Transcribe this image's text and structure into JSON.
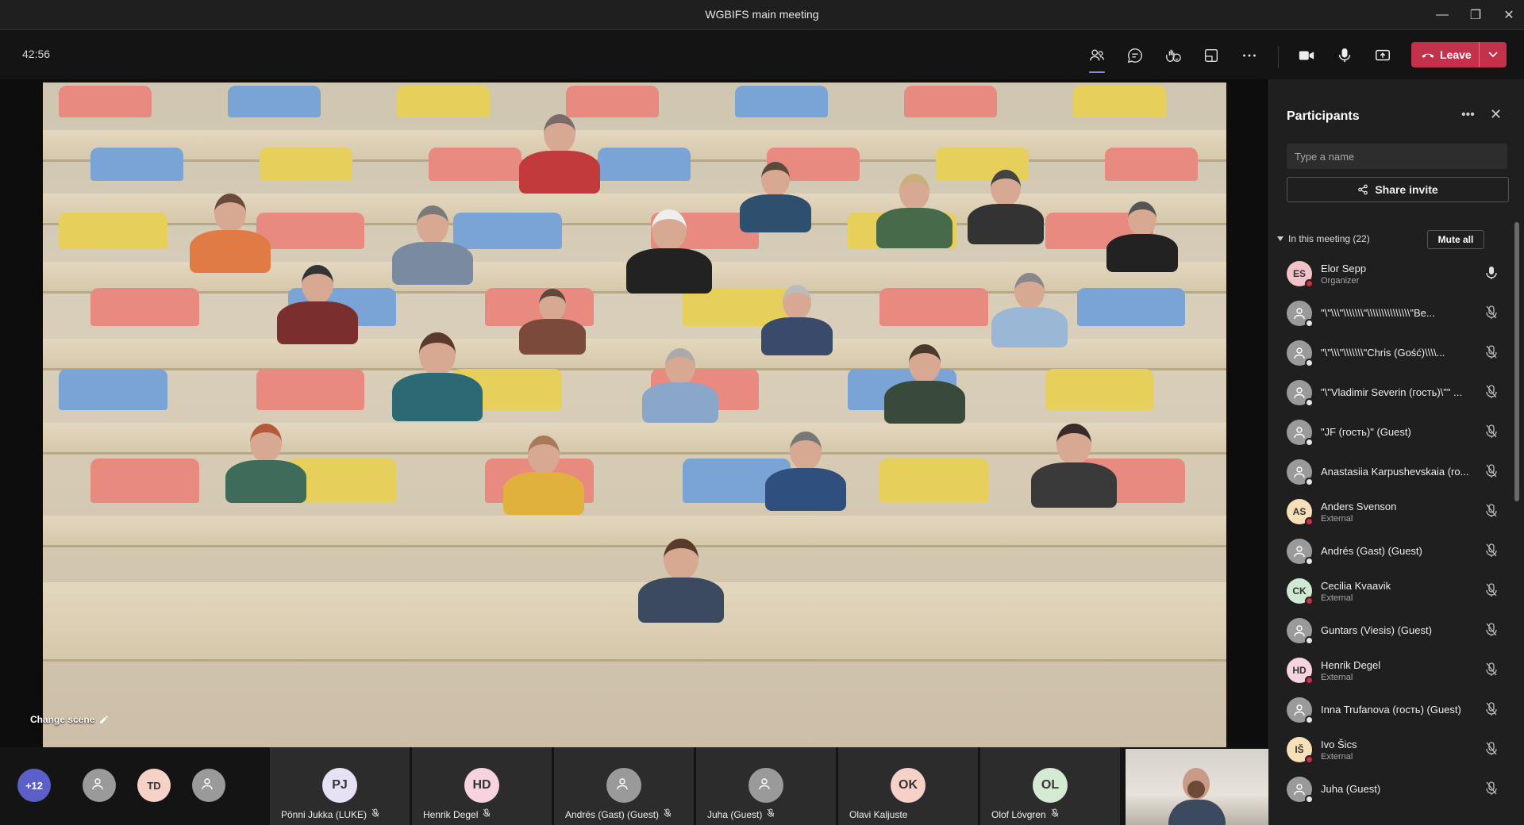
{
  "window": {
    "title": "WGBIFS main meeting"
  },
  "toolbar": {
    "timer": "42:56",
    "leave_label": "Leave"
  },
  "stage": {
    "change_scene_label": "Change scene"
  },
  "panel": {
    "title": "Participants",
    "search_placeholder": "Type a name",
    "share_label": "Share invite",
    "in_meeting_label": "In this meeting (22)",
    "mute_all_label": "Mute all",
    "participants": [
      {
        "name": "Elor Sepp",
        "sub": "Organizer",
        "initials": "ES",
        "color": "#f3c1c8",
        "status": "#c4314b",
        "mic": "on"
      },
      {
        "name": "\"\\\"\\\\\\\"\\\\\\\\\\\\\\\"\\\\\\\\\\\\\\\\\\\\\\\\\\\\\\\"Be...",
        "sub": "",
        "initials": "",
        "color": "generic",
        "status": "#e6e6e6",
        "mic": "off"
      },
      {
        "name": "\"\\\"\\\\\\\"\\\\\\\\\\\\\\\"Chris (Gość)\\\\\\\\...",
        "sub": "",
        "initials": "",
        "color": "generic",
        "status": "#e6e6e6",
        "mic": "off"
      },
      {
        "name": "\"\\\"Vladimir Severin (гость)\\\"\" ...",
        "sub": "",
        "initials": "",
        "color": "generic",
        "status": "#e6e6e6",
        "mic": "off"
      },
      {
        "name": "\"JF (гость)\" (Guest)",
        "sub": "",
        "initials": "",
        "color": "generic",
        "status": "#e6e6e6",
        "mic": "off"
      },
      {
        "name": "Anastasiia Karpushevskaia (ro...",
        "sub": "",
        "initials": "",
        "color": "generic",
        "status": "#e6e6e6",
        "mic": "off"
      },
      {
        "name": "Anders Svenson",
        "sub": "External",
        "initials": "AS",
        "color": "#f7dfb8",
        "status": "#c4314b",
        "mic": "off"
      },
      {
        "name": "Andrés (Gast) (Guest)",
        "sub": "",
        "initials": "",
        "color": "generic",
        "status": "#e6e6e6",
        "mic": "off"
      },
      {
        "name": "Cecilia Kvaavik",
        "sub": "External",
        "initials": "CK",
        "color": "#cfe9d3",
        "status": "#c4314b",
        "mic": "off"
      },
      {
        "name": "Guntars (Viesis) (Guest)",
        "sub": "",
        "initials": "",
        "color": "generic",
        "status": "#e6e6e6",
        "mic": "off"
      },
      {
        "name": "Henrik Degel",
        "sub": "External",
        "initials": "HD",
        "color": "#f6d3df",
        "status": "#c4314b",
        "mic": "off"
      },
      {
        "name": "Inna Trufanova (гость) (Guest)",
        "sub": "",
        "initials": "",
        "color": "generic",
        "status": "#e6e6e6",
        "mic": "off"
      },
      {
        "name": "Ivo Šics",
        "sub": "External",
        "initials": "IŠ",
        "color": "#f7dfb8",
        "status": "#c4314b",
        "mic": "off"
      },
      {
        "name": "Juha (Guest)",
        "sub": "",
        "initials": "",
        "color": "generic",
        "status": "#e6e6e6",
        "mic": "off"
      }
    ]
  },
  "strip": {
    "overflow_count": "+12",
    "overflow_avatars": [
      {
        "initials": "",
        "color": "generic"
      },
      {
        "initials": "TD",
        "color": "#f6d1c8"
      },
      {
        "initials": "",
        "color": "generic"
      }
    ],
    "tiles": [
      {
        "name": "Pönni Jukka (LUKE)",
        "initials": "PJ",
        "color": "#e6e1f5",
        "muted": true
      },
      {
        "name": "Henrik Degel",
        "initials": "HD",
        "color": "#f6d3df",
        "muted": true
      },
      {
        "name": "Andrés (Gast) (Guest)",
        "initials": "",
        "color": "generic",
        "muted": true
      },
      {
        "name": "Juha (Guest)",
        "initials": "",
        "color": "generic",
        "muted": true
      },
      {
        "name": "Olavi Kaljuste",
        "initials": "OK",
        "color": "#f6d1c8",
        "muted": false
      },
      {
        "name": "Olof Lövgren",
        "initials": "OL",
        "color": "#d4ead3",
        "muted": true
      }
    ]
  },
  "colors": {
    "accent": "#8b8cc7",
    "leave": "#c4314b"
  }
}
